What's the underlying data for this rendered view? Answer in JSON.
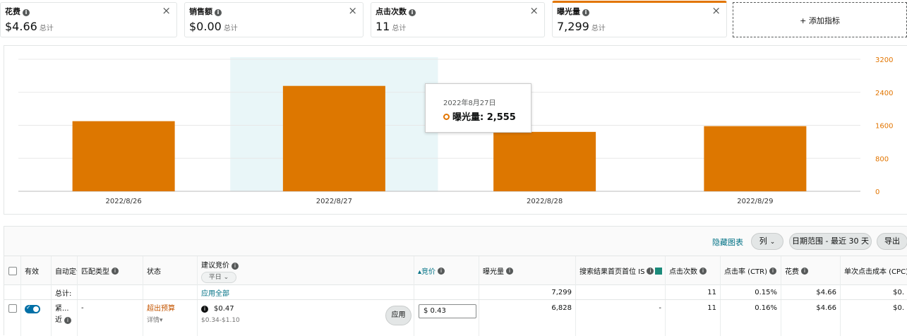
{
  "metric_cards": [
    {
      "label": "花费",
      "value": "$4.66",
      "sum": "总计",
      "active": false
    },
    {
      "label": "销售额",
      "value": "$0.00",
      "sum": "总计",
      "active": false
    },
    {
      "label": "点击次数",
      "value": "11",
      "sum": "总计",
      "active": false
    },
    {
      "label": "曝光量",
      "value": "7,299",
      "sum": "总计",
      "active": true
    }
  ],
  "add_metric_label": "+ 添加指标",
  "close_glyph": "×",
  "info_glyph": "i",
  "colors": {
    "accent": "#e27500",
    "bar": "#dd7700",
    "link": "#007185",
    "highlight": "#e9f6f8"
  },
  "chart_data": {
    "type": "bar",
    "categories": [
      "2022/8/26",
      "2022/8/27",
      "2022/8/28",
      "2022/8/29"
    ],
    "series": [
      {
        "name": "曝光量",
        "values": [
          1700,
          2555,
          1440,
          1580
        ]
      }
    ],
    "ylim": [
      0,
      3200
    ],
    "yticks": [
      "3200",
      "2400",
      "1600",
      "800",
      "0"
    ],
    "highlighted_category": "2022/8/27",
    "grid": true,
    "y_axis_position": "right"
  },
  "tooltip": {
    "date": "2022年8月27日",
    "label": "曝光量: 2,555"
  },
  "toolbar": {
    "hide_chart": "隐藏图表",
    "columns": "列",
    "date_range": "日期范围 - 最近 30 天",
    "export": "导出",
    "chevron": "⌄"
  },
  "table": {
    "headers": {
      "active": "有效",
      "auto": "自动定位",
      "match_type": "匹配类型",
      "status": "状态",
      "suggested_bid": "建议竞价",
      "suggested_bid_mode": "平日 ⌄",
      "bid": "▴竞价",
      "impressions": "曝光量",
      "top_search_is": "搜索结果首页首位 IS",
      "clicks": "点击次数",
      "ctr": "点击率 (CTR)",
      "spend": "花费",
      "cpc": "单次点击成本 (CPC)"
    },
    "total_row": {
      "label": "总计:",
      "apply_all": "应用全部",
      "impressions": "7,299",
      "clicks": "11",
      "ctr": "0.15%",
      "spend": "$4.66",
      "cpc": "$0."
    },
    "rows": [
      {
        "auto_line1": "紧...",
        "auto_line2": "近",
        "match_type": "-",
        "status": "超出预算",
        "status_detail": "详情▾",
        "suggested_bid": "$0.47",
        "suggested_range": "$0.34-$1.10",
        "apply": "应用",
        "bid_value": "$   0.43",
        "impressions": "6,828",
        "top_search_is": "-",
        "clicks": "11",
        "ctr": "0.16%",
        "spend": "$4.66",
        "cpc": "$0."
      }
    ]
  }
}
